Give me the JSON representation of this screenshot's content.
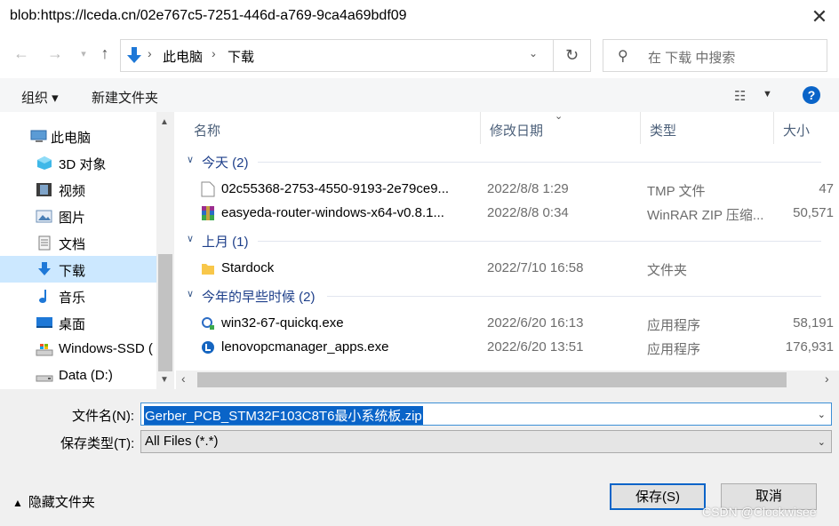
{
  "window": {
    "title": "blob:https://lceda.cn/02e767c5-7251-446d-a769-9ca4a69bdf09",
    "close_glyph": "✕"
  },
  "address": {
    "crumbs": [
      "此电脑",
      "下载"
    ],
    "separator": "›",
    "search_placeholder": "在 下载 中搜索"
  },
  "toolbar": {
    "organize": "组织 ▾",
    "new_folder": "新建文件夹",
    "help": "?"
  },
  "nav": {
    "items": [
      {
        "label": "此电脑",
        "icon": "computer-icon"
      },
      {
        "label": "3D 对象",
        "icon": "3d-objects-icon"
      },
      {
        "label": "视频",
        "icon": "videos-icon"
      },
      {
        "label": "图片",
        "icon": "pictures-icon"
      },
      {
        "label": "文档",
        "icon": "documents-icon"
      },
      {
        "label": "下载",
        "icon": "downloads-icon",
        "selected": true
      },
      {
        "label": "音乐",
        "icon": "music-icon"
      },
      {
        "label": "桌面",
        "icon": "desktop-icon"
      },
      {
        "label": "Windows-SSD (",
        "icon": "drive-icon"
      },
      {
        "label": "Data (D:)",
        "icon": "drive-icon"
      }
    ]
  },
  "columns": {
    "name": "名称",
    "date": "修改日期",
    "type": "类型",
    "size": "大小"
  },
  "groups": [
    {
      "label": "今天 (2)",
      "files": [
        {
          "name": "02c55368-2753-4550-9193-2e79ce9...",
          "date": "2022/8/8 1:29",
          "type": "TMP 文件",
          "size": "47",
          "icon": "tmp-file-icon"
        },
        {
          "name": "easyeda-router-windows-x64-v0.8.1...",
          "date": "2022/8/8 0:34",
          "type": "WinRAR ZIP 压缩...",
          "size": "50,571",
          "icon": "winrar-icon"
        }
      ]
    },
    {
      "label": "上月 (1)",
      "files": [
        {
          "name": "Stardock",
          "date": "2022/7/10 16:58",
          "type": "文件夹",
          "size": "",
          "icon": "folder-icon"
        }
      ]
    },
    {
      "label": "今年的早些时候 (2)",
      "files": [
        {
          "name": "win32-67-quickq.exe",
          "date": "2022/6/20 16:13",
          "type": "应用程序",
          "size": "58,191",
          "icon": "quickq-app-icon"
        },
        {
          "name": "lenovopcmanager_apps.exe",
          "date": "2022/6/20 13:51",
          "type": "应用程序",
          "size": "176,931",
          "icon": "lenovo-app-icon"
        }
      ]
    }
  ],
  "save": {
    "filename_label": "文件名(N):",
    "filename_value": "Gerber_PCB_STM32F103C8T6最小系统板.zip",
    "filetype_label": "保存类型(T):",
    "filetype_value": "All Files (*.*)",
    "hide_folders": "隐藏文件夹",
    "save_button": "保存(S)",
    "cancel_button": "取消"
  },
  "watermark": "CSDN @Clockwisee",
  "colors": {
    "accent": "#0a64c8",
    "selection": "#cce8ff",
    "group_text": "#1e3f8a"
  }
}
